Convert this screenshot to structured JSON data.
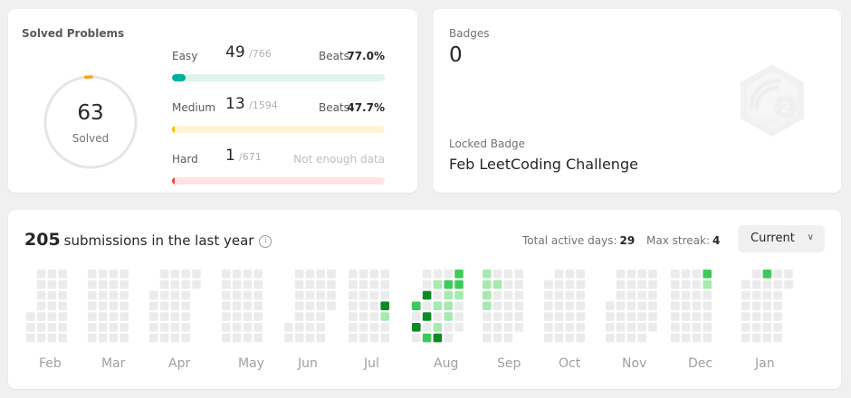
{
  "solved": {
    "title": "Solved Problems",
    "total": "63",
    "total_label": "Solved",
    "difficulties": [
      {
        "name": "Easy",
        "count": "49",
        "total": "/766",
        "beats_label": "Beats",
        "beats": "77.0%",
        "progress": 0.064,
        "fill": "#00af9b",
        "track": "#dff5ea"
      },
      {
        "name": "Medium",
        "count": "13",
        "total": "/1594",
        "beats_label": "Beats",
        "beats": "47.7%",
        "progress": 0.008,
        "fill": "#ffb800",
        "track": "#fff4d6"
      },
      {
        "name": "Hard",
        "count": "1",
        "total": "/671",
        "note": "Not enough data",
        "progress": 0.0015,
        "fill": "#ef4743",
        "track": "#fde3e3"
      }
    ],
    "ring_progress": 0.02,
    "ring_color": "#ffa116"
  },
  "badges": {
    "label": "Badges",
    "count": "0",
    "locked_label": "Locked Badge",
    "locked_name": "Feb LeetCoding Challenge",
    "icon": "feb-badge-icon"
  },
  "submissions": {
    "count": "205",
    "text": "submissions in the last year",
    "active_days_label": "Total active days:",
    "active_days": "29",
    "max_streak_label": "Max streak:",
    "max_streak": "4",
    "dropdown": "Current",
    "months": [
      "Feb",
      "Mar",
      "Apr",
      "May",
      "Jun",
      "Jul",
      "Aug",
      "Sep",
      "Oct",
      "Nov",
      "Dec",
      "Jan"
    ],
    "colors": {
      "empty": "#ebebeb",
      "light": "#a7e9af",
      "mid": "#3dca5a",
      "dark": "#0e8a25"
    }
  }
}
